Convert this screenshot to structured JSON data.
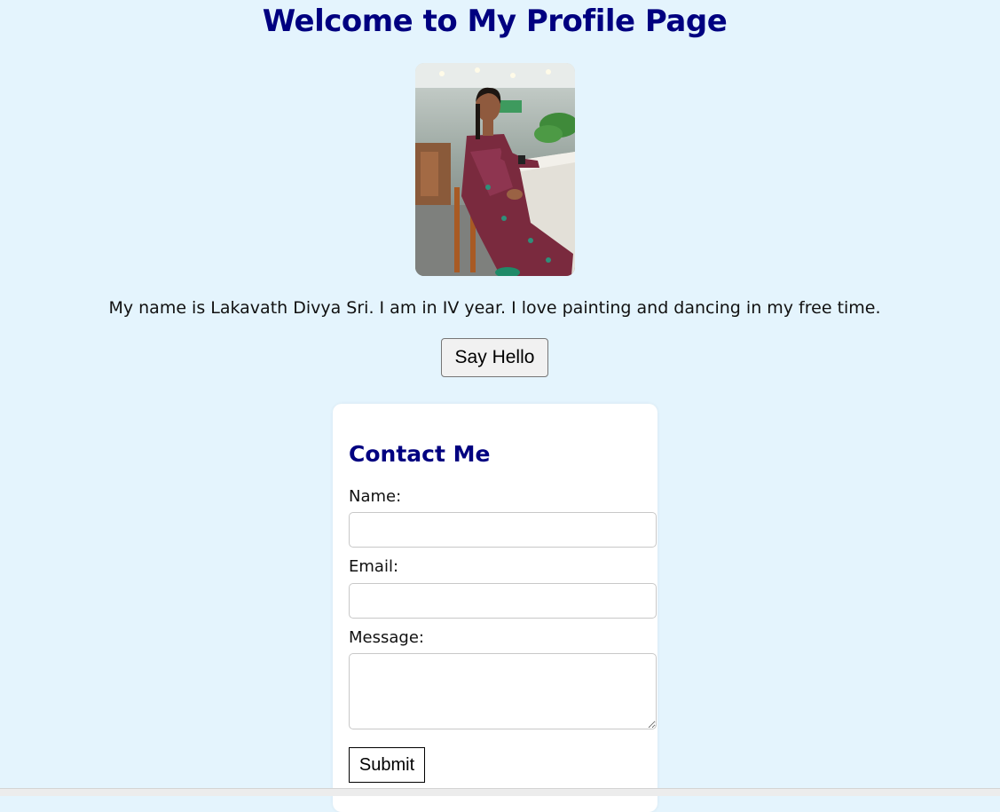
{
  "header": {
    "title": "Welcome to My Profile Page"
  },
  "profile": {
    "photo_icon": "profile-photo",
    "bio": "My name is Lakavath Divya Sri. I am in IV year. I love painting and dancing in my free time.",
    "say_hello_label": "Say Hello"
  },
  "contact": {
    "heading": "Contact Me",
    "name_label": "Name:",
    "name_value": "",
    "email_label": "Email:",
    "email_value": "",
    "message_label": "Message:",
    "message_value": "",
    "submit_label": "Submit"
  },
  "colors": {
    "background": "#e4f4fd",
    "heading": "#000080",
    "card": "#ffffff"
  }
}
